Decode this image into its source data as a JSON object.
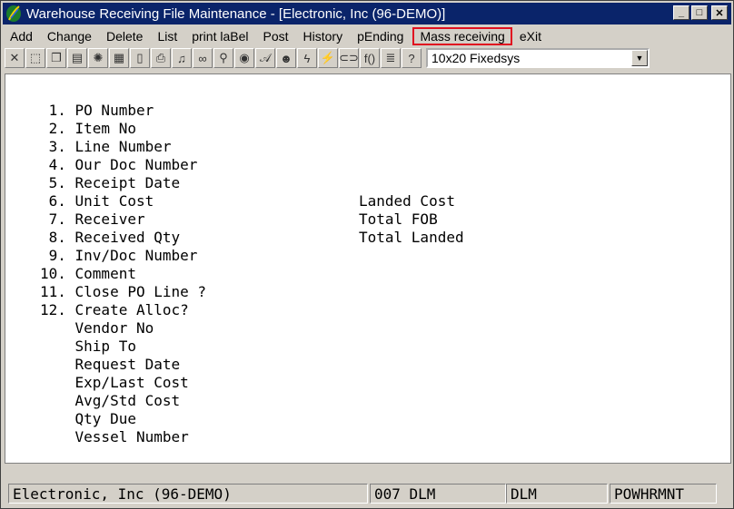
{
  "window": {
    "title": "Warehouse Receiving File Maintenance - [Electronic, Inc (96-DEMO)]",
    "icon": "app-feather-icon",
    "buttons": [
      "_",
      "□",
      "✕"
    ]
  },
  "menu": [
    {
      "label": "Add"
    },
    {
      "label": "Change"
    },
    {
      "label": "Delete"
    },
    {
      "label": "List"
    },
    {
      "label": "print laBel"
    },
    {
      "label": "Post"
    },
    {
      "label": "History"
    },
    {
      "label": "pEnding"
    },
    {
      "label": "Mass receiving"
    },
    {
      "label": "eXit"
    }
  ],
  "toolbar": {
    "tools": [
      {
        "name": "cancel-icon",
        "glyph": "✕"
      },
      {
        "name": "select-icon",
        "glyph": "⬚"
      },
      {
        "name": "copy-icon",
        "glyph": "❐"
      },
      {
        "name": "paste-icon",
        "glyph": "▤"
      },
      {
        "name": "settings-icon",
        "glyph": "✺"
      },
      {
        "name": "form-icon",
        "glyph": "▦"
      },
      {
        "name": "page-icon",
        "glyph": "▯"
      },
      {
        "name": "print-icon",
        "glyph": "⎙"
      },
      {
        "name": "bell-icon",
        "glyph": "♫"
      },
      {
        "name": "binoculars-icon",
        "glyph": "∞"
      },
      {
        "name": "search-icon",
        "glyph": "⚲"
      },
      {
        "name": "globe-icon",
        "glyph": "◉"
      },
      {
        "name": "script-icon",
        "glyph": "𝒜"
      },
      {
        "name": "user-icon",
        "glyph": "☻"
      },
      {
        "name": "lightning-icon",
        "glyph": "ϟ"
      },
      {
        "name": "wizard-icon",
        "glyph": "⚡"
      },
      {
        "name": "link-icon",
        "glyph": "⊂⊃"
      },
      {
        "name": "function-icon",
        "glyph": "f()"
      },
      {
        "name": "notes-icon",
        "glyph": "≣"
      },
      {
        "name": "help-pointer-icon",
        "glyph": "?"
      }
    ],
    "font_select": "10x20 Fixedsys"
  },
  "form": {
    "left_fields": [
      " 1. PO Number",
      " 2. Item No",
      " 3. Line Number",
      " 4. Our Doc Number",
      " 5. Receipt Date",
      " 6. Unit Cost",
      " 7. Receiver",
      " 8. Received Qty",
      " 9. Inv/Doc Number",
      "10. Comment",
      "11. Close PO Line ?",
      "12. Create Alloc?",
      "    Vendor No",
      "    Ship To",
      "    Request Date",
      "    Exp/Last Cost",
      "    Avg/Std Cost",
      "    Qty Due",
      "    Vessel Number"
    ],
    "right_fields": [
      "Landed Cost",
      "Total FOB",
      "Total Landed"
    ]
  },
  "status": {
    "company": "Electronic, Inc (96-DEMO)",
    "session": "007 DLM",
    "user": "DLM",
    "program": "POWHRMNT"
  },
  "colors": {
    "titlebar": "#0a246a",
    "highlight_box": "#e01020"
  }
}
